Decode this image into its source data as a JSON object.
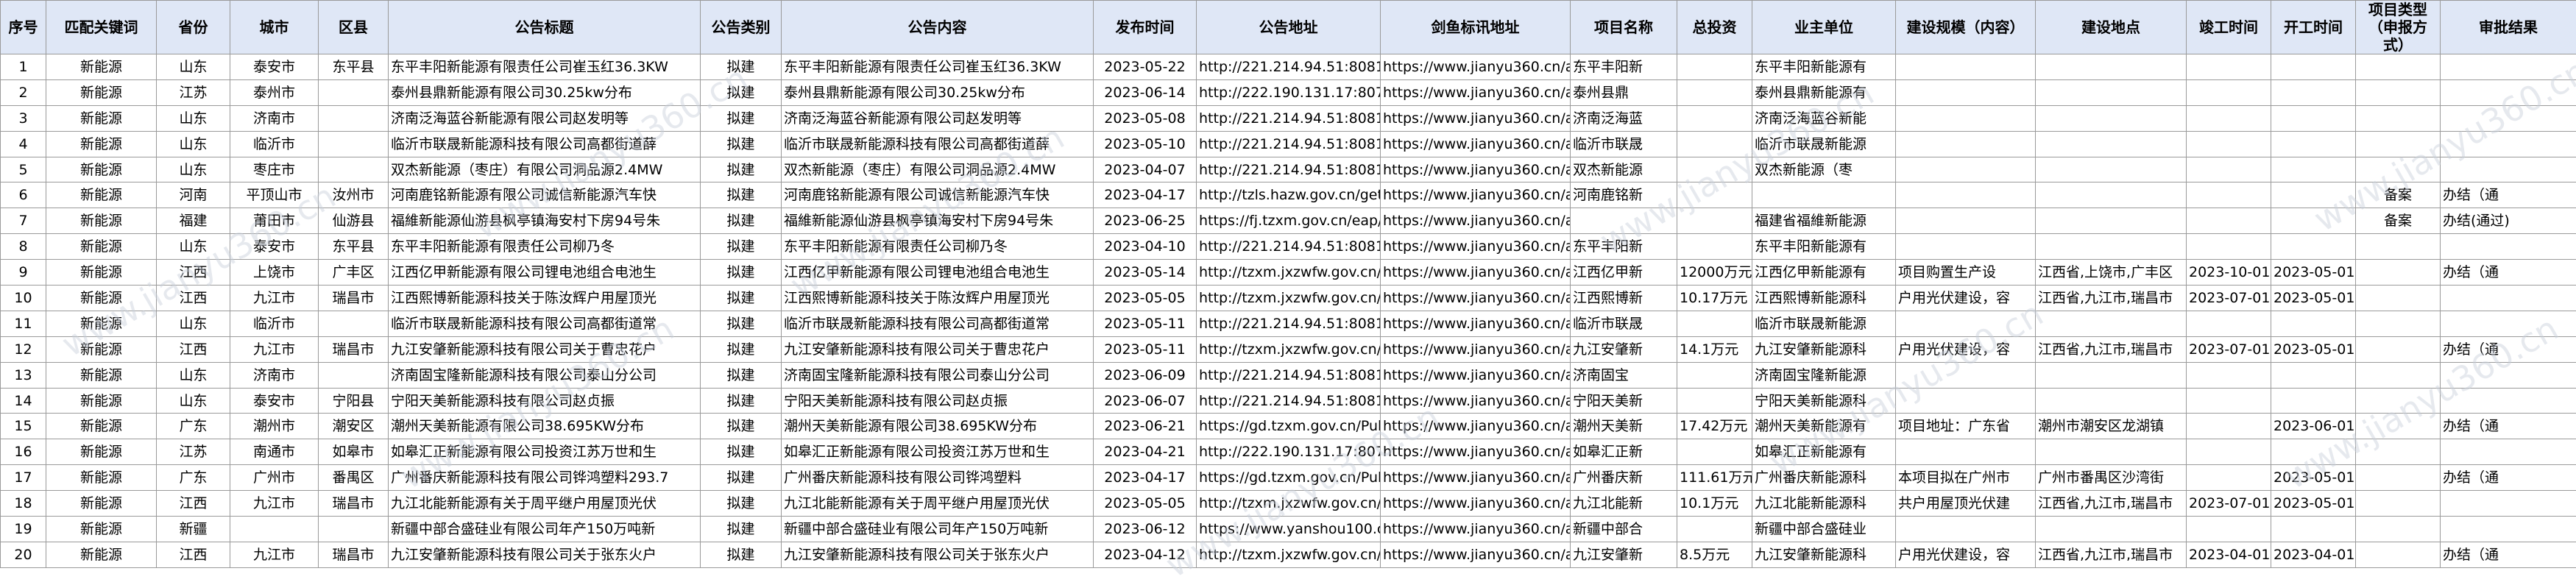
{
  "columns": [
    "序号",
    "匹配关键词",
    "省份",
    "城市",
    "区县",
    "公告标题",
    "公告类别",
    "公告内容",
    "发布时间",
    "公告地址",
    "剑鱼标讯地址",
    "项目名称",
    "总投资",
    "业主单位",
    "建设规模（内容）",
    "建设地点",
    "竣工时间",
    "开工时间",
    "项目类型（申报方式）",
    "审批结果"
  ],
  "rows": [
    [
      "1",
      "新能源",
      "山东",
      "泰安市",
      "东平县",
      "东平丰阳新能源有限责任公司崔玉红36.3KW",
      "拟建",
      "东平丰阳新能源有限责任公司崔玉红36.3KW",
      "2023-05-22",
      "http://221.214.94.51:8081/ici",
      "https://www.jianyu360.cn/ar",
      "东平丰阳新",
      "",
      "东平丰阳新能源有",
      "",
      "",
      "",
      "",
      "",
      ""
    ],
    [
      "2",
      "新能源",
      "江苏",
      "泰州市",
      "",
      "泰州县鼎新能源有限公司30.25kw分布",
      "拟建",
      "泰州县鼎新能源有限公司30.25kw分布",
      "2023-06-14",
      "http://222.190.131.17:8075/",
      "https://www.jianyu360.cn/ar",
      "泰州县鼎",
      "",
      "泰州县鼎新能源有",
      "",
      "",
      "",
      "",
      "",
      ""
    ],
    [
      "3",
      "新能源",
      "山东",
      "济南市",
      "",
      "济南泛海蓝谷新能源有限公司赵发明等",
      "拟建",
      "济南泛海蓝谷新能源有限公司赵发明等",
      "2023-05-08",
      "http://221.214.94.51:8081/ici",
      "https://www.jianyu360.cn/ar",
      "济南泛海蓝",
      "",
      "济南泛海蓝谷新能",
      "",
      "",
      "",
      "",
      "",
      ""
    ],
    [
      "4",
      "新能源",
      "山东",
      "临沂市",
      "",
      "临沂市联晟新能源科技有限公司高都街道薛",
      "拟建",
      "临沂市联晟新能源科技有限公司高都街道薛",
      "2023-05-10",
      "http://221.214.94.51:8081/ici",
      "https://www.jianyu360.cn/ar",
      "临沂市联晟",
      "",
      "临沂市联晟新能源",
      "",
      "",
      "",
      "",
      "",
      ""
    ],
    [
      "5",
      "新能源",
      "山东",
      "枣庄市",
      "",
      "双杰新能源（枣庄）有限公司洞品源2.4MW",
      "拟建",
      "双杰新能源（枣庄）有限公司洞品源2.4MW",
      "2023-04-07",
      "http://221.214.94.51:8081/ici",
      "https://www.jianyu360.cn/ar",
      "双杰新能源",
      "",
      "双杰新能源（枣",
      "",
      "",
      "",
      "",
      "",
      ""
    ],
    [
      "6",
      "新能源",
      "河南",
      "平顶山市",
      "汝州市",
      "河南鹿铭新能源有限公司诚信新能源汽车快",
      "拟建",
      "河南鹿铭新能源有限公司诚信新能源汽车快",
      "2023-04-17",
      "http://tzls.hazw.gov.cn/gets",
      "https://www.jianyu360.cn/ar",
      "河南鹿铭新",
      "",
      "",
      "",
      "",
      "",
      "",
      "备案",
      "办结（通"
    ],
    [
      "7",
      "新能源",
      "福建",
      "莆田市",
      "仙游县",
      "福維新能源仙游县枫亭镇海安村下房94号朱",
      "拟建",
      "福維新能源仙游县枫亭镇海安村下房94号朱",
      "2023-06-25",
      "https://fj.tzxm.gov.cn/eap/c",
      "https://www.jianyu360.cn/ar",
      "",
      "",
      "福建省福維新能源",
      "",
      "",
      "",
      "",
      "备案",
      "办结(通过)"
    ],
    [
      "8",
      "新能源",
      "山东",
      "泰安市",
      "东平县",
      "东平丰阳新能源有限责任公司柳乃冬",
      "拟建",
      "东平丰阳新能源有限责任公司柳乃冬",
      "2023-04-10",
      "http://221.214.94.51:8081/ici",
      "https://www.jianyu360.cn/ar",
      "东平丰阳新",
      "",
      "东平丰阳新能源有",
      "",
      "",
      "",
      "",
      "",
      ""
    ],
    [
      "9",
      "新能源",
      "江西",
      "上饶市",
      "广丰区",
      "江西亿甲新能源有限公司锂电池组合电池生",
      "拟建",
      "江西亿甲新能源有限公司锂电池组合电池生",
      "2023-05-14",
      "http://tzxm.jxzwfw.gov.cn/",
      "https://www.jianyu360.cn/ar",
      "江西亿甲新",
      "12000万元",
      "江西亿甲新能源有",
      "项目购置生产设",
      "江西省,上饶市,广丰区",
      "2023-10-01",
      "2023-05-01",
      "",
      "办结（通"
    ],
    [
      "10",
      "新能源",
      "江西",
      "九江市",
      "瑞昌市",
      "江西熙博新能源科技关于陈汝辉户用屋顶光",
      "拟建",
      "江西熙博新能源科技关于陈汝辉户用屋顶光",
      "2023-05-05",
      "http://tzxm.jxzwfw.gov.cn/",
      "https://www.jianyu360.cn/ar",
      "江西熙博新",
      "10.17万元",
      "江西熙博新能源科",
      "户用光伏建设，容",
      "江西省,九江市,瑞昌市",
      "2023-07-01",
      "2023-05-01",
      "",
      ""
    ],
    [
      "11",
      "新能源",
      "山东",
      "临沂市",
      "",
      "临沂市联晟新能源科技有限公司高都街道常",
      "拟建",
      "临沂市联晟新能源科技有限公司高都街道常",
      "2023-05-11",
      "http://221.214.94.51:8081/ici",
      "https://www.jianyu360.cn/ar",
      "临沂市联晟",
      "",
      "临沂市联晟新能源",
      "",
      "",
      "",
      "",
      "",
      ""
    ],
    [
      "12",
      "新能源",
      "江西",
      "九江市",
      "瑞昌市",
      "九江安肇新能源科技有限公司关于曹忠花户",
      "拟建",
      "九江安肇新能源科技有限公司关于曹忠花户",
      "2023-05-11",
      "http://tzxm.jxzwfw.gov.cn/",
      "https://www.jianyu360.cn/ar",
      "九江安肇新",
      "14.1万元",
      "九江安肇新能源科",
      "户用光伏建设，容",
      "江西省,九江市,瑞昌市",
      "2023-07-01",
      "2023-05-01",
      "",
      "办结（通"
    ],
    [
      "13",
      "新能源",
      "山东",
      "济南市",
      "",
      "济南固宝隆新能源科技有限公司泰山分公司",
      "拟建",
      "济南固宝隆新能源科技有限公司泰山分公司",
      "2023-06-09",
      "http://221.214.94.51:8081/ici",
      "https://www.jianyu360.cn/ar",
      "济南固宝",
      "",
      "济南固宝隆新能源",
      "",
      "",
      "",
      "",
      "",
      ""
    ],
    [
      "14",
      "新能源",
      "山东",
      "泰安市",
      "宁阳县",
      "宁阳天美新能源科技有限公司赵贞振",
      "拟建",
      "宁阳天美新能源科技有限公司赵贞振",
      "2023-06-07",
      "http://221.214.94.51:8081/ici",
      "https://www.jianyu360.cn/ar",
      "宁阳天美新",
      "",
      "宁阳天美新能源科",
      "",
      "",
      "",
      "",
      "",
      ""
    ],
    [
      "15",
      "新能源",
      "广东",
      "潮州市",
      "潮安区",
      "潮州天美新能源有限公司38.695KW分布",
      "拟建",
      "潮州天美新能源有限公司38.695KW分布",
      "2023-06-21",
      "https://gd.tzxm.gov.cn/Publ",
      "https://www.jianyu360.cn/ar",
      "潮州天美新",
      "17.42万元",
      "潮州天美新能源有",
      "项目地址：广东省",
      "潮州市潮安区龙湖镇",
      "",
      "2023-06-01",
      "",
      "办结（通"
    ],
    [
      "16",
      "新能源",
      "江苏",
      "南通市",
      "如皋市",
      "如皋汇正新能源有限公司投资江苏万世和生",
      "拟建",
      "如皋汇正新能源有限公司投资江苏万世和生",
      "2023-04-21",
      "http://222.190.131.17:8075/",
      "https://www.jianyu360.cn/ar",
      "如皋汇正新",
      "",
      "如皋汇正新能源有",
      "",
      "",
      "",
      "",
      "",
      ""
    ],
    [
      "17",
      "新能源",
      "广东",
      "广州市",
      "番禺区",
      "广州番庆新能源科技有限公司铧鸿塑料293.7",
      "拟建",
      "广州番庆新能源科技有限公司铧鸿塑料",
      "2023-04-17",
      "https://gd.tzxm.gov.cn/Publ",
      "https://www.jianyu360.cn/ar",
      "广州番庆新",
      "111.61万元",
      "广州番庆新能源科",
      "本项目拟在广州市",
      "广州市番禺区沙湾街",
      "",
      "2023-05-01",
      "",
      "办结（通"
    ],
    [
      "18",
      "新能源",
      "江西",
      "九江市",
      "瑞昌市",
      "九江北能新能源有关于周平继户用屋顶光伏",
      "拟建",
      "九江北能新能源有关于周平继户用屋顶光伏",
      "2023-05-05",
      "http://tzxm.jxzwfw.gov.cn/",
      "https://www.jianyu360.cn/ar",
      "九江北能新",
      "10.1万元",
      "九江北能新能源科",
      "共户用屋顶光伏建",
      "江西省,九江市,瑞昌市",
      "2023-07-01",
      "2023-05-01",
      "",
      ""
    ],
    [
      "19",
      "新能源",
      "新疆",
      "",
      "",
      "新疆中部合盛硅业有限公司年产150万吨新",
      "拟建",
      "新疆中部合盛硅业有限公司年产150万吨新",
      "2023-06-12",
      "https://www.yanshou100.co",
      "https://www.jianyu360.cn/ar",
      "新疆中部合",
      "",
      "新疆中部合盛硅业",
      "",
      "",
      "",
      "",
      "",
      ""
    ],
    [
      "20",
      "新能源",
      "江西",
      "九江市",
      "瑞昌市",
      "九江安肇新能源科技有限公司关于张东火户",
      "拟建",
      "九江安肇新能源科技有限公司关于张东火户",
      "2023-04-12",
      "http://tzxm.jxzwfw.gov.cn/",
      "https://www.jianyu360.cn/ar",
      "九江安肇新",
      "8.5万元",
      "九江安肇新能源科",
      "户用光伏建设，容",
      "江西省,九江市,瑞昌市",
      "2023-04-01",
      "2023-04-01",
      "",
      "办结（通"
    ]
  ],
  "watermark": "www.jianyu360.cn"
}
